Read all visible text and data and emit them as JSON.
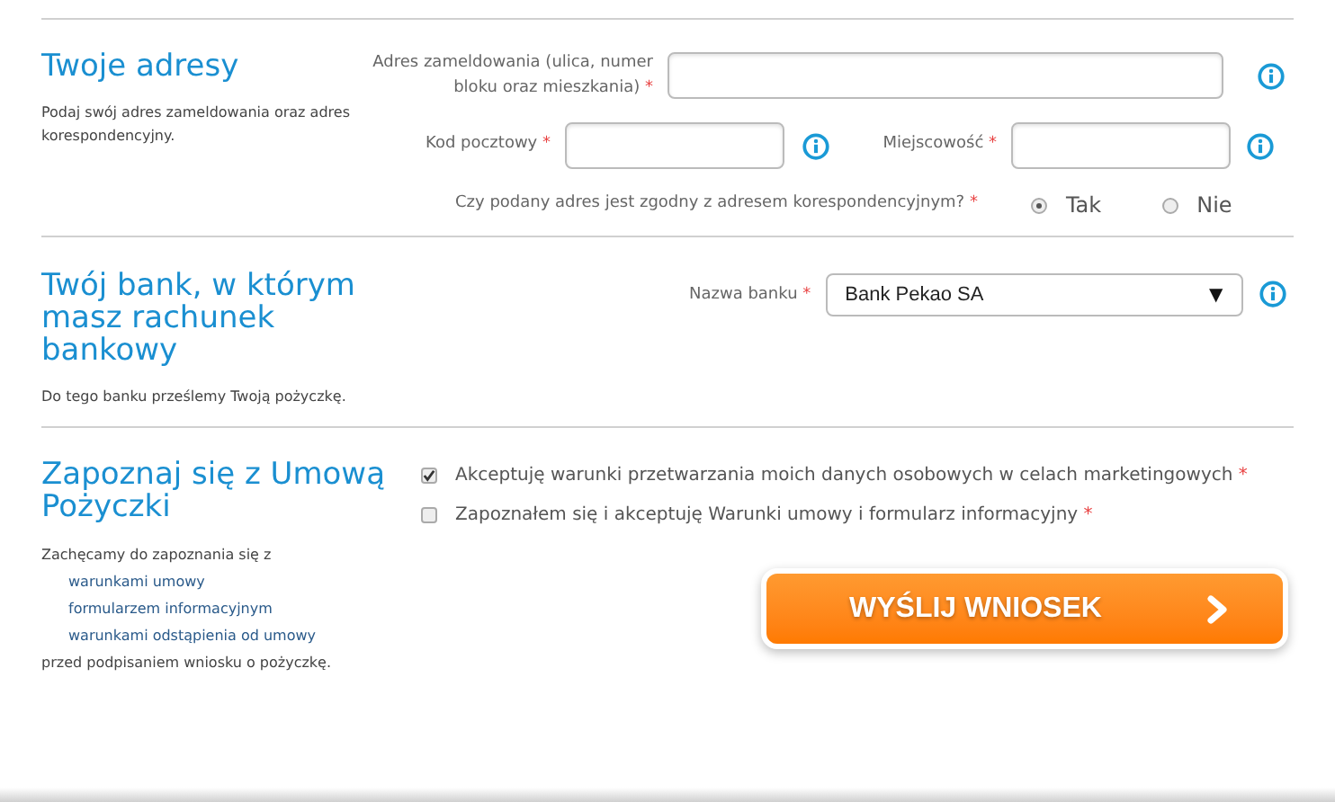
{
  "sections": [
    {
      "title": "Twoje adresy",
      "description": "Podaj swój adres zameldowania oraz adres korespondencyjny."
    },
    {
      "title": "Twój bank, w którym masz rachunek bankowy",
      "description": "Do tego banku prześlemy Twoją pożyczkę."
    },
    {
      "title": "Zapoznaj się z Umową Pożyczki",
      "intro": "Zachęcamy do zapoznania się z",
      "links": [
        "warunkami umowy",
        "formularzem informacyjnym",
        "warunkami odstąpienia od umowy"
      ],
      "outro": "przed podpisaniem wniosku o pożyczkę."
    }
  ],
  "address": {
    "label": "Adres zameldowania (ulica, numer bloku oraz mieszkania)",
    "required": "*"
  },
  "postal_code": {
    "label": "Kod pocztowy",
    "required": "*"
  },
  "city": {
    "label": "Miejscowość",
    "required": "*"
  },
  "same_address": {
    "question": "Czy podany adres jest zgodny z adresem korespondencyjnym?",
    "required": "*",
    "options": [
      {
        "label": "Tak",
        "selected": true
      },
      {
        "label": "Nie",
        "selected": false
      }
    ]
  },
  "bank": {
    "label": "Nazwa banku",
    "required": "*",
    "value": "Bank Pekao SA",
    "arrow": "▼"
  },
  "consents": [
    {
      "label": "Akceptuję warunki przetwarzania moich danych osobowych w celach marketingowych",
      "required": "*",
      "checked": true
    },
    {
      "label": "Zapoznałem się i akceptuję Warunki umowy i formularz informacyjny",
      "required": "*",
      "checked": false
    }
  ],
  "submit": {
    "label": "WYŚLIJ WNIOSEK"
  }
}
